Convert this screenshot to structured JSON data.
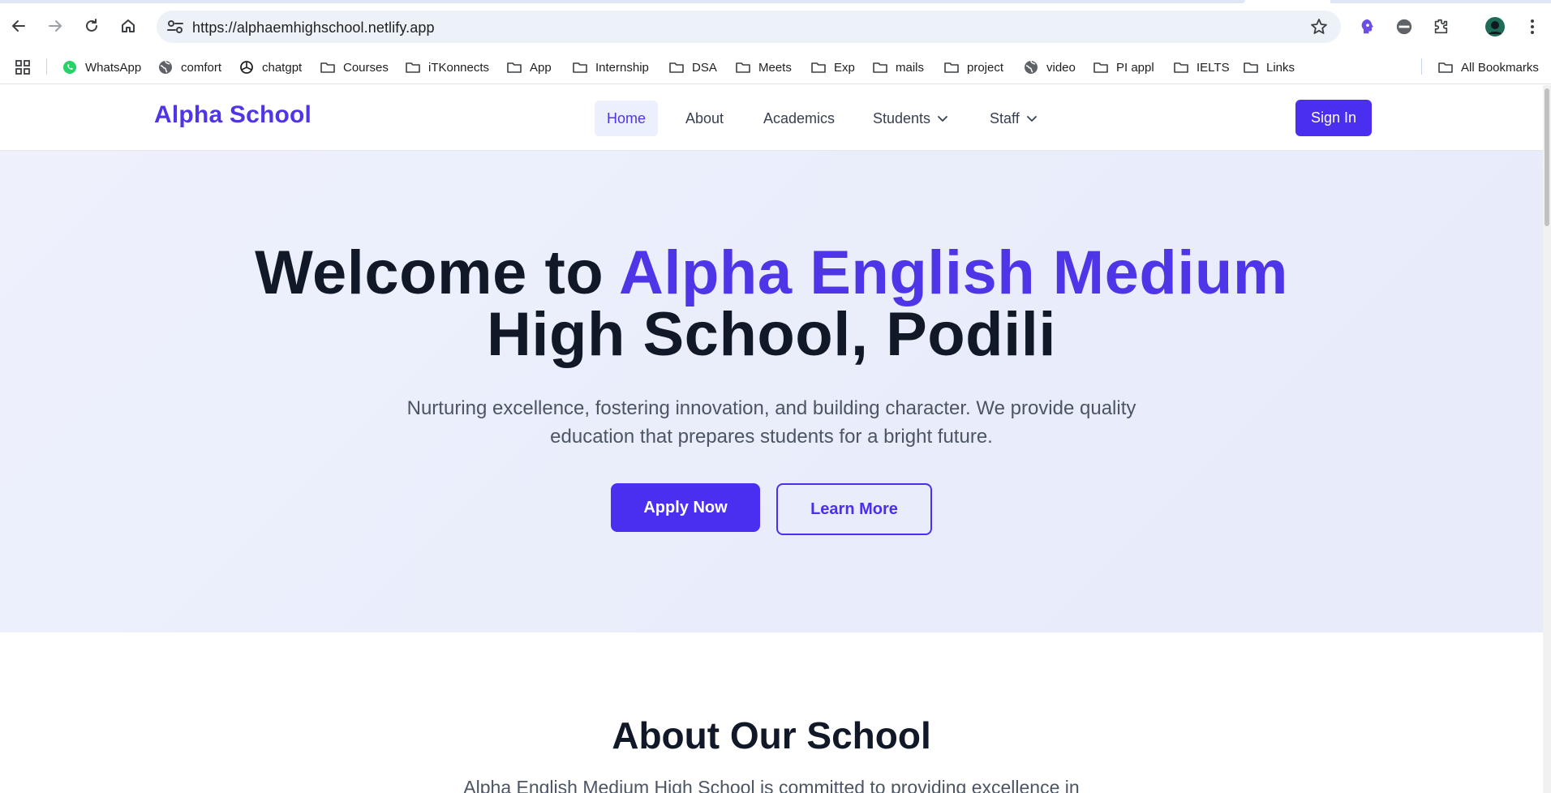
{
  "browser": {
    "url": "https://alphaemhighschool.netlify.app",
    "bookmarks": [
      {
        "label": "WhatsApp",
        "icon": "whatsapp-icon"
      },
      {
        "label": "comfort",
        "icon": "globe-icon"
      },
      {
        "label": "chatgpt",
        "icon": "openai-icon"
      },
      {
        "label": "Courses",
        "icon": "folder-icon"
      },
      {
        "label": "iTKonnects",
        "icon": "folder-icon"
      },
      {
        "label": "App",
        "icon": "folder-icon"
      },
      {
        "label": "Internship",
        "icon": "folder-icon"
      },
      {
        "label": "DSA",
        "icon": "folder-icon"
      },
      {
        "label": "Meets",
        "icon": "folder-icon"
      },
      {
        "label": "Exp",
        "icon": "folder-icon"
      },
      {
        "label": "mails",
        "icon": "folder-icon"
      },
      {
        "label": "project",
        "icon": "folder-icon"
      },
      {
        "label": "video",
        "icon": "globe-icon"
      },
      {
        "label": "PI appl",
        "icon": "folder-icon"
      },
      {
        "label": "IELTS",
        "icon": "folder-icon"
      },
      {
        "label": "Links",
        "icon": "folder-icon"
      }
    ],
    "all_bookmarks": "All Bookmarks"
  },
  "site": {
    "brand": "Alpha School",
    "nav": [
      {
        "label": "Home",
        "active": true
      },
      {
        "label": "About"
      },
      {
        "label": "Academics"
      },
      {
        "label": "Students",
        "dropdown": true
      },
      {
        "label": "Staff",
        "dropdown": true
      }
    ],
    "sign_in": "Sign In"
  },
  "hero": {
    "title_prefix": "Welcome to ",
    "title_accent": "Alpha English Medium",
    "title_line2": "High School, Podili",
    "subtitle_line1": "Nurturing excellence, fostering innovation, and building character. We provide quality",
    "subtitle_line2": "education that prepares students for a bright future.",
    "apply_label": "Apply Now",
    "learn_label": "Learn More"
  },
  "about": {
    "title": "About Our School",
    "text": "Alpha English Medium High School is committed to providing excellence in"
  },
  "colors": {
    "brand": "#4f35e8",
    "button": "#4a2ff0",
    "heading": "#111827",
    "body_text": "#4b5563",
    "hero_bg": "#eceffc"
  }
}
